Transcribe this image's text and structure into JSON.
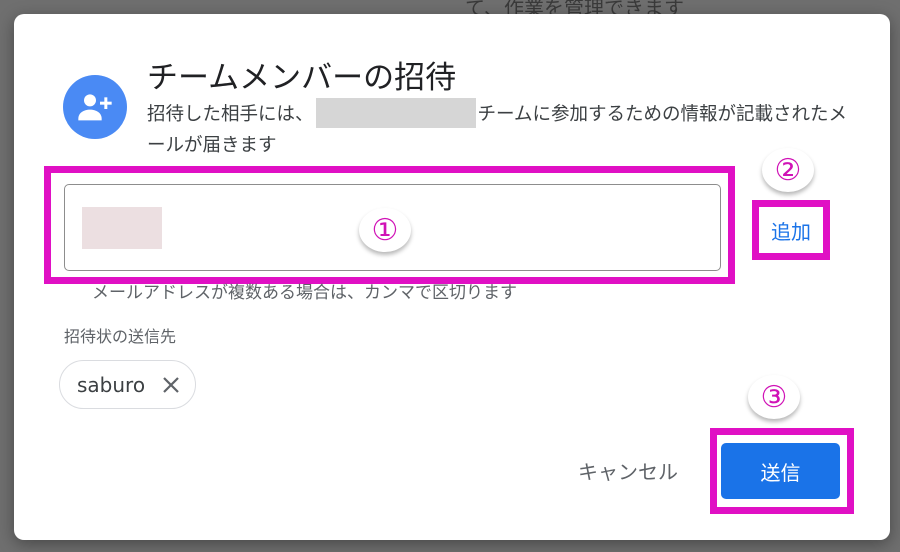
{
  "background": {
    "partial_text": "て、作業を管理できます"
  },
  "dialog": {
    "title": "チームメンバーの招待",
    "description_before": "招待した相手には、",
    "description_after": "チームに参加するための情報が記載されたメールが届きます",
    "avatar_icon": "person-add-icon",
    "email_input": {
      "value": "",
      "placeholder": ""
    },
    "hint": "メールアドレスが複数ある場合は、カンマで区切ります",
    "add_label": "追加",
    "recipients_label": "招待状の送信先",
    "recipients": [
      {
        "name": "saburo"
      }
    ],
    "cancel_label": "キャンセル",
    "send_label": "送信"
  },
  "annotations": {
    "marker_1": "①",
    "marker_2": "②",
    "marker_3": "③",
    "highlight_color": "#e010c4"
  },
  "colors": {
    "accent": "#1a73e8",
    "avatar": "#4a8af4"
  }
}
